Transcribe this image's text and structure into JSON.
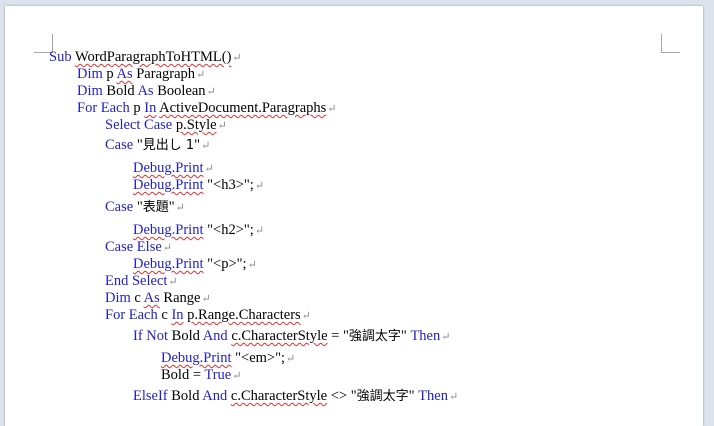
{
  "document": {
    "paragraph_mark": "↵",
    "lines": [
      [
        {
          "t": "Sub",
          "k": 1
        },
        {
          "t": " "
        },
        {
          "t": "WordParagraphToHTML()",
          "s": 1
        }
      ],
      [
        {
          "t": "Dim",
          "k": 1
        },
        {
          "t": " p "
        },
        {
          "t": "As",
          "k": 1,
          "s": 1
        },
        {
          "t": " Paragraph"
        }
      ],
      [
        {
          "t": "Dim",
          "k": 1
        },
        {
          "t": " Bold "
        },
        {
          "t": "As",
          "k": 1
        },
        {
          "t": " Boolean"
        }
      ],
      [
        {
          "t": "For Each",
          "k": 1
        },
        {
          "t": " p "
        },
        {
          "t": "In",
          "k": 1,
          "s": 1
        },
        {
          "t": " "
        },
        {
          "t": "ActiveDocument.Paragraphs",
          "s": 1
        }
      ],
      [
        {
          "t": "Select Case",
          "k": 1
        },
        {
          "t": " "
        },
        {
          "t": "p.Style",
          "s": 1
        }
      ],
      [
        {
          "t": "Case",
          "k": 1
        },
        {
          "t": " \""
        },
        {
          "t": "見出し 1",
          "j": 1
        },
        {
          "t": "\""
        }
      ],
      [
        {
          "t": "Debug.Print",
          "k": 1,
          "s": 1
        }
      ],
      [
        {
          "t": "Debug.Print",
          "k": 1,
          "s": 1
        },
        {
          "t": " \"<h3>\";"
        }
      ],
      [
        {
          "t": "Case",
          "k": 1
        },
        {
          "t": " \""
        },
        {
          "t": "表題",
          "j": 1
        },
        {
          "t": "\""
        }
      ],
      [
        {
          "t": "Debug.Print",
          "k": 1,
          "s": 1
        },
        {
          "t": " \"<h2>\";"
        }
      ],
      [
        {
          "t": "Case Else",
          "k": 1
        }
      ],
      [
        {
          "t": "Debug.Print",
          "k": 1,
          "s": 1
        },
        {
          "t": " \"<p>\";"
        }
      ],
      [
        {
          "t": "End Select",
          "k": 1
        }
      ],
      [
        {
          "t": "Dim",
          "k": 1
        },
        {
          "t": " c "
        },
        {
          "t": "As",
          "k": 1,
          "s": 1
        },
        {
          "t": " Range"
        }
      ],
      [
        {
          "t": "For Each",
          "k": 1
        },
        {
          "t": " c "
        },
        {
          "t": "In",
          "k": 1,
          "s": 1
        },
        {
          "t": " "
        },
        {
          "t": "p.Range.Characters",
          "s": 1
        }
      ],
      [
        {
          "t": "If Not",
          "k": 1
        },
        {
          "t": " Bold "
        },
        {
          "t": "And",
          "k": 1
        },
        {
          "t": " "
        },
        {
          "t": "c.CharacterStyle",
          "s": 1
        },
        {
          "t": " = \""
        },
        {
          "t": "強調太字",
          "j": 1
        },
        {
          "t": "\" "
        },
        {
          "t": "Then",
          "k": 1
        }
      ],
      [
        {
          "t": "Debug.Print",
          "k": 1,
          "s": 1
        },
        {
          "t": " \"<em>\";"
        }
      ],
      [
        {
          "t": "Bold = "
        },
        {
          "t": "True",
          "k": 1
        }
      ],
      [
        {
          "t": "ElseIf",
          "k": 1
        },
        {
          "t": " Bold "
        },
        {
          "t": "And",
          "k": 1
        },
        {
          "t": " "
        },
        {
          "t": "c.CharacterStyle",
          "s": 1
        },
        {
          "t": " <> \""
        },
        {
          "t": "強調太字",
          "j": 1
        },
        {
          "t": "\" "
        },
        {
          "t": "Then",
          "k": 1
        }
      ]
    ]
  }
}
